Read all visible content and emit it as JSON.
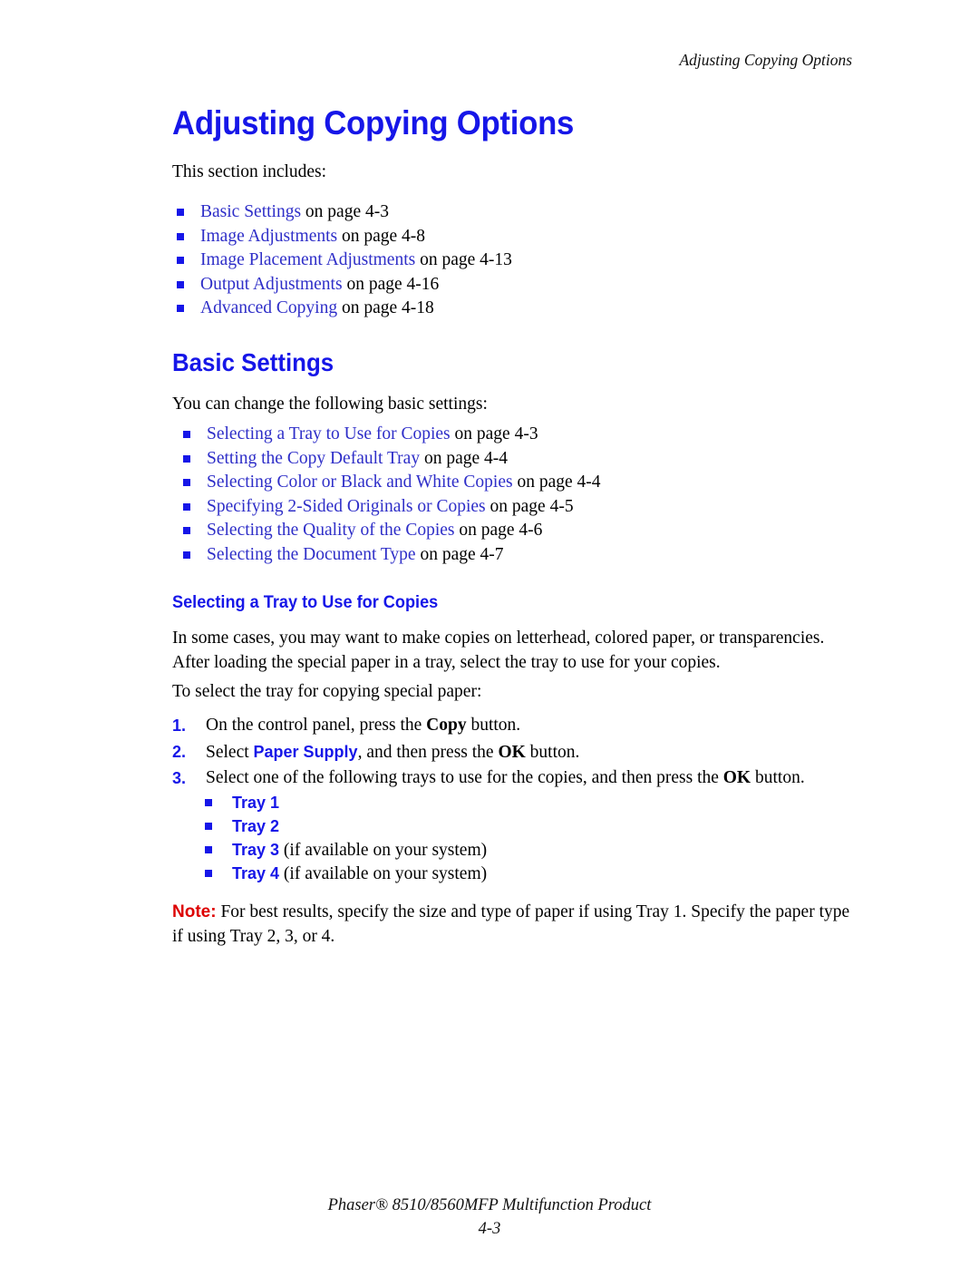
{
  "header": {
    "running_head": "Adjusting Copying Options"
  },
  "chapter": {
    "title": "Adjusting Copying Options",
    "intro": "This section includes:"
  },
  "includes_list": [
    {
      "link": "Basic Settings",
      "tail": " on page 4-3"
    },
    {
      "link": "Image Adjustments",
      "tail": " on page 4-8"
    },
    {
      "link": "Image Placement Adjustments",
      "tail": " on page 4-13"
    },
    {
      "link": "Output Adjustments",
      "tail": " on page 4-16"
    },
    {
      "link": "Advanced Copying",
      "tail": " on page 4-18"
    }
  ],
  "basic_settings": {
    "title": "Basic Settings",
    "intro": "You can change the following basic settings:",
    "list": [
      {
        "link": "Selecting a Tray to Use for Copies",
        "tail": " on page 4-3"
      },
      {
        "link": "Setting the Copy Default Tray",
        "tail": " on page 4-4"
      },
      {
        "link": "Selecting Color or Black and White Copies",
        "tail": " on page 4-4"
      },
      {
        "link": "Specifying 2-Sided Originals or Copies",
        "tail": " on page 4-5"
      },
      {
        "link": "Selecting the Quality of the Copies",
        "tail": " on page 4-6"
      },
      {
        "link": "Selecting the Document Type",
        "tail": " on page 4-7"
      }
    ]
  },
  "selecting_tray": {
    "title": "Selecting a Tray to Use for Copies",
    "paragraph1": "In some cases, you may want to make copies on letterhead, colored paper, or transparencies. After loading the special paper in a tray, select the tray to use for your copies.",
    "paragraph2": "To select the tray for copying special paper:",
    "steps": [
      {
        "number": "1.",
        "pre": "On the control panel, press the ",
        "kbd": "Copy",
        "post": " button."
      },
      {
        "number": "2.",
        "pre": "Select ",
        "ui": "Paper Supply",
        "mid": ", and then press the ",
        "kbd": "OK",
        "post": " button."
      },
      {
        "number": "3.",
        "pre": "Select one of the following trays to use for the copies, and then press the ",
        "kbd": "OK",
        "post": " button."
      }
    ],
    "trays": [
      {
        "name": "Tray 1",
        "note": ""
      },
      {
        "name": "Tray 2",
        "note": ""
      },
      {
        "name": "Tray 3",
        "note": " (if available on your system)"
      },
      {
        "name": "Tray 4",
        "note": " (if available on your system)"
      }
    ],
    "note": {
      "label": "Note:",
      "text": " For best results, specify the size and type of paper if using Tray 1. Specify the paper type if using Tray 2, 3, or 4."
    }
  },
  "footer": {
    "product": "Phaser® 8510/8560MFP Multifunction Product",
    "page_number": "4-3"
  },
  "colors": {
    "heading_blue": "#1616E8",
    "link_blue": "#2E2EC8",
    "note_red": "#DD0000",
    "text_black": "#000000"
  }
}
